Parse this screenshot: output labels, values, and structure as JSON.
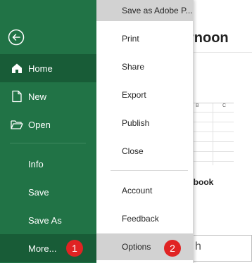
{
  "sidebar": {
    "items": [
      {
        "label": "Home",
        "icon": "home-icon",
        "active": true
      },
      {
        "label": "New",
        "icon": "new-document-icon"
      },
      {
        "label": "Open",
        "icon": "open-folder-icon"
      },
      {
        "label": "Info"
      },
      {
        "label": "Save"
      },
      {
        "label": "Save As"
      },
      {
        "label": "More..."
      }
    ]
  },
  "menu": {
    "items": [
      {
        "label": "Save as Adobe P..."
      },
      {
        "label": "Print"
      },
      {
        "label": "Share"
      },
      {
        "label": "Export"
      },
      {
        "label": "Publish"
      },
      {
        "label": "Close"
      },
      {
        "label": "Account"
      },
      {
        "label": "Feedback"
      },
      {
        "label": "Options"
      }
    ]
  },
  "badges": [
    "1",
    "2"
  ],
  "background": {
    "greeting_fragment": "rnoon",
    "workbook_fragment": "kbook",
    "search_fragment": "h",
    "sheet_columns": [
      "B",
      "C"
    ]
  },
  "colors": {
    "sidebar_bg": "#217346",
    "sidebar_active": "#185c37",
    "menu_highlight": "#d2d2d2",
    "badge": "#e02323"
  }
}
